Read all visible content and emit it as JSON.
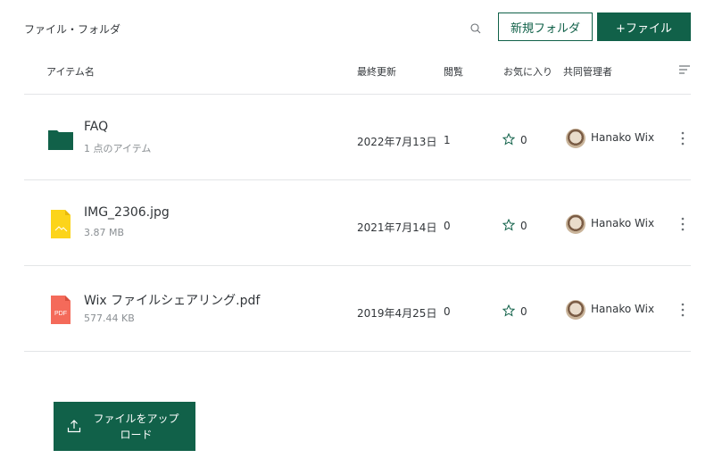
{
  "breadcrumb": "ファイル・フォルダ",
  "toolbar": {
    "new_folder_label": "新規フォルダ",
    "add_file_label": "+ファイル"
  },
  "columns": {
    "name": "アイテム名",
    "modified": "最終更新",
    "views": "閲覧",
    "favorites": "お気に入り",
    "co_admins": "共同管理者"
  },
  "rows": [
    {
      "name": "FAQ",
      "sub": "1 点のアイテム",
      "modified": "2022年7月13日",
      "views": "1",
      "favorites": "0",
      "owner": "Hanako Wix",
      "icon": "folder-icon"
    },
    {
      "name": "IMG_2306.jpg",
      "sub": "3.87 MB",
      "modified": "2021年7月14日",
      "views": "0",
      "favorites": "0",
      "owner": "Hanako Wix",
      "icon": "image-file-icon"
    },
    {
      "name": "Wix ファイルシェアリング.pdf",
      "sub": "577.44 KB",
      "modified": "2019年4月25日",
      "views": "0",
      "favorites": "0",
      "owner": "Hanako Wix",
      "icon": "pdf-file-icon",
      "icon_text": "PDF"
    }
  ],
  "upload": {
    "label": "ファイルをアップロード",
    "line1": "ファイルをアップ",
    "line2": "ロード"
  },
  "colors": {
    "brand": "#116149",
    "folder": "#116149",
    "image_file": "#fcd41a",
    "pdf_file": "#f46a5a"
  }
}
